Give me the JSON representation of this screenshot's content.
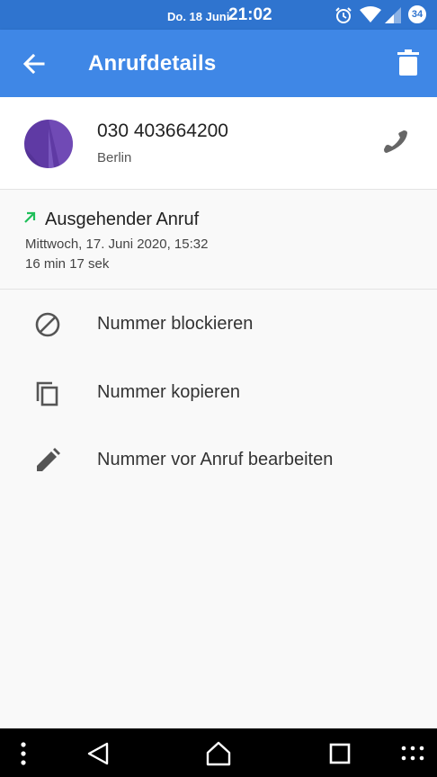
{
  "status_bar": {
    "date": "Do. 18 Juni",
    "time": "21:02",
    "battery": "34",
    "icons": [
      "alarm-icon",
      "wifi-icon",
      "signal-icon",
      "battery-icon"
    ]
  },
  "app_bar": {
    "title": "Anrufdetails",
    "back_icon": "arrow-back-icon",
    "delete_icon": "trash-icon",
    "background": "#3f87e6"
  },
  "contact": {
    "number": "030 403664200",
    "location": "Berlin",
    "call_icon": "phone-icon"
  },
  "call": {
    "type": "Ausgehender Anruf",
    "datetime": "Mittwoch, 17. Juni 2020, 15:32",
    "duration": "16 min 17 sek",
    "type_icon_color": "#1fbf5a"
  },
  "actions": [
    {
      "label": "Nummer blockieren",
      "icon": "block-icon"
    },
    {
      "label": "Nummer kopieren",
      "icon": "copy-icon"
    },
    {
      "label": "Nummer vor Anruf bearbeiten",
      "icon": "edit-icon"
    }
  ],
  "nav_bar": {
    "items": [
      "menu-dots-icon",
      "back-triangle-icon",
      "home-icon",
      "recents-square-icon",
      "apps-grid-icon"
    ]
  }
}
